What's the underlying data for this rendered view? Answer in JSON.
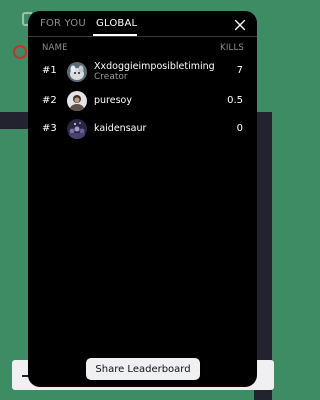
{
  "tabs": [
    {
      "label": "FOR YOU",
      "active": false
    },
    {
      "label": "GLOBAL",
      "active": true
    }
  ],
  "columns": {
    "name": "NAME",
    "kills": "KILLS"
  },
  "leaderboard": [
    {
      "rank": "#1",
      "name": "Xxdoggieimposibletiming",
      "role": "Creator",
      "kills": "7",
      "avatar": "avatar-dog-icon"
    },
    {
      "rank": "#2",
      "name": "puresoy",
      "role": "",
      "kills": "0.5",
      "avatar": "avatar-person-icon"
    },
    {
      "rank": "#3",
      "name": "kaidensaur",
      "role": "",
      "kills": "0",
      "avatar": "avatar-crowd-icon"
    }
  ],
  "share_button": {
    "label": "Share Leaderboard"
  },
  "colors": {
    "background": "#3d8c63",
    "modal": "#000000",
    "accent": "#ffffff",
    "muted": "#8d8d8d"
  }
}
